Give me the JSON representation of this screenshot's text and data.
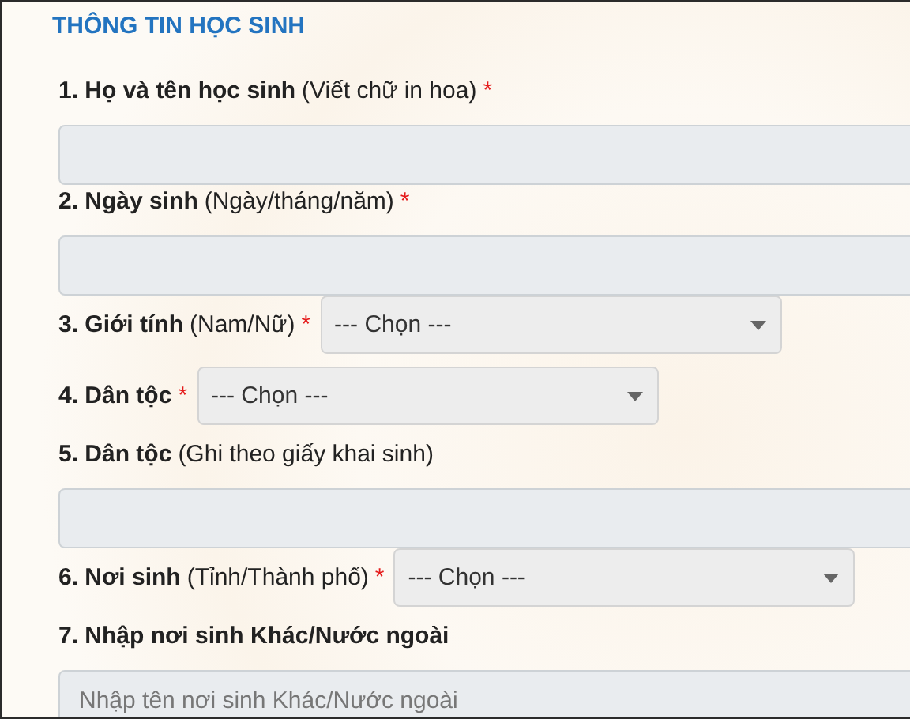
{
  "section_title": "THÔNG TIN HỌC SINH",
  "fields": [
    {
      "kind": "text",
      "label": "1. Họ và tên học sinh",
      "note": "(Viết chữ in hoa)",
      "required_mark": "*"
    },
    {
      "kind": "text",
      "label": "2. Ngày sinh",
      "note": "(Ngày/tháng/năm)",
      "required_mark": "*"
    },
    {
      "kind": "select",
      "label": "3. Giới tính",
      "note": "(Nam/Nữ)",
      "required_mark": "*",
      "value": "--- Chọn ---"
    },
    {
      "kind": "select",
      "label": "4. Dân tộc",
      "required_mark": "*",
      "value": "--- Chọn ---"
    },
    {
      "kind": "text",
      "label": "5. Dân tộc",
      "note": "(Ghi theo giấy khai sinh)"
    },
    {
      "kind": "select",
      "label": "6. Nơi sinh",
      "note": "(Tỉnh/Thành phố)",
      "required_mark": "*",
      "value": "--- Chọn ---"
    },
    {
      "kind": "text",
      "label": "7. Nhập nơi sinh Khác/Nước ngoài",
      "placeholder": "Nhập tên nơi sinh Khác/Nước ngoài"
    }
  ]
}
